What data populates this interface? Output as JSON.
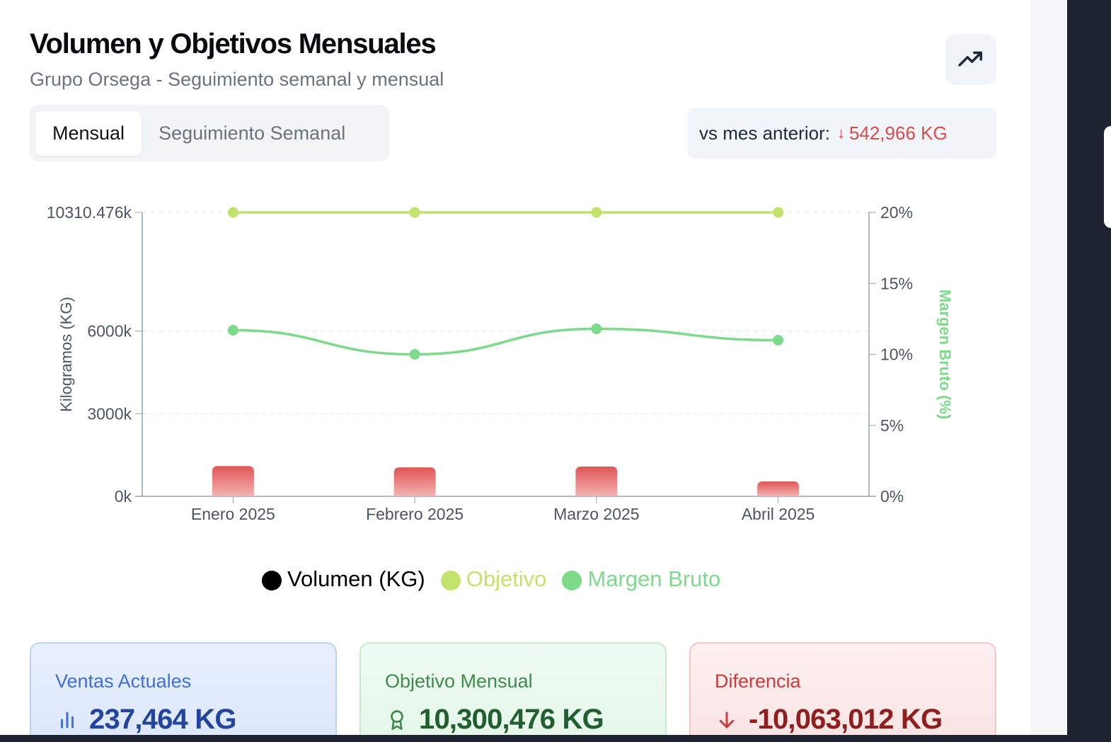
{
  "header": {
    "title": "Volumen y Objetivos Mensuales",
    "subtitle": "Grupo Orsega - Seguimiento semanal y mensual",
    "trend_icon": "trending-up-icon"
  },
  "tabs": [
    {
      "label": "Mensual",
      "active": true
    },
    {
      "label": "Seguimiento Semanal",
      "active": false
    }
  ],
  "comparison": {
    "label": "vs mes anterior:",
    "arrow": "↓",
    "value": "542,966 KG",
    "color": "#dc4a4a"
  },
  "chart_data": {
    "type": "bar",
    "categories": [
      "Enero 2025",
      "Febrero 2025",
      "Marzo 2025",
      "Abril 2025"
    ],
    "ylabel": "Kilogramos (KG)",
    "y2label": "Margen Bruto (%)",
    "y_ticks": [
      "0k",
      "3000k",
      "6000k",
      "10310.476k"
    ],
    "y_tick_values": [
      0,
      3000,
      6000,
      10310.476
    ],
    "ylim": [
      0,
      10310.476
    ],
    "y2_ticks": [
      "0%",
      "5%",
      "10%",
      "15%",
      "20%"
    ],
    "y2_tick_values": [
      0,
      5,
      10,
      15,
      20
    ],
    "y2lim": [
      0,
      20
    ],
    "grid": true,
    "legend_position": "bottom",
    "series": [
      {
        "name": "Volumen (KG)",
        "type": "bar",
        "axis": "left",
        "values": [
          1100,
          1050,
          1080,
          540
        ],
        "color": "#e05555",
        "legend_color": "#000000"
      },
      {
        "name": "Objetivo",
        "type": "line",
        "axis": "right",
        "values": [
          20,
          20,
          20,
          20
        ],
        "color": "#c2e36b"
      },
      {
        "name": "Margen Bruto",
        "type": "line",
        "axis": "right",
        "values": [
          11.7,
          10.0,
          11.8,
          11.0
        ],
        "color": "#7cda8a"
      }
    ]
  },
  "stats": [
    {
      "label": "Ventas Actuales",
      "value": "237,464 KG",
      "icon": "bar-chart-icon"
    },
    {
      "label": "Objetivo Mensual",
      "value": "10,300,476 KG",
      "icon": "award-icon"
    },
    {
      "label": "Diferencia",
      "value": "-10,063,012 KG",
      "icon": "arrow-down-icon"
    }
  ]
}
